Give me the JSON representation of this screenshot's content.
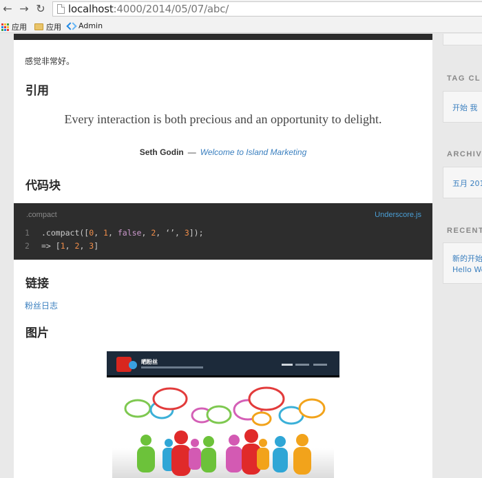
{
  "browser": {
    "url_host": "localhost",
    "url_path": ":4000/2014/05/07/abc/",
    "bookmarks": [
      {
        "label": "应用",
        "icon": "apps-grid-icon"
      },
      {
        "label": "应用",
        "icon": "folder-icon"
      },
      {
        "label": "Admin",
        "icon": "admin-icon"
      }
    ]
  },
  "post": {
    "intro_text": "感觉非常好。",
    "quote_heading": "引用",
    "quote_text": "Every interaction is both precious and an opportunity to delight.",
    "quote_author": "Seth Godin",
    "quote_dash": "—",
    "quote_source": "Welcome to Island Marketing",
    "code_heading": "代码块",
    "code": {
      "title": ".compact",
      "link": "Underscore.js",
      "lines": [
        {
          "num": "1",
          "text": ".compact([0, 1, false, 2, ‘’, 3]);"
        },
        {
          "num": "2",
          "text": "=> [1, 2, 3]"
        }
      ]
    },
    "link_heading": "链接",
    "link_text": "粉丝日志",
    "image_heading": "图片",
    "image": {
      "site_name": "晒粉丝"
    }
  },
  "sidebar": {
    "tag_title": "TAG CL",
    "tag_items": "开始 我",
    "archive_title": "ARCHIV",
    "archive_items": "五月 201",
    "recent_title": "RECENT",
    "recent_items": [
      "新的开始",
      "Hello Wo"
    ]
  },
  "colors": {
    "link": "#3a7fbf",
    "code_bg": "#2d2d2d",
    "code_number": "#f08d49",
    "code_keyword": "#cc99cd"
  }
}
